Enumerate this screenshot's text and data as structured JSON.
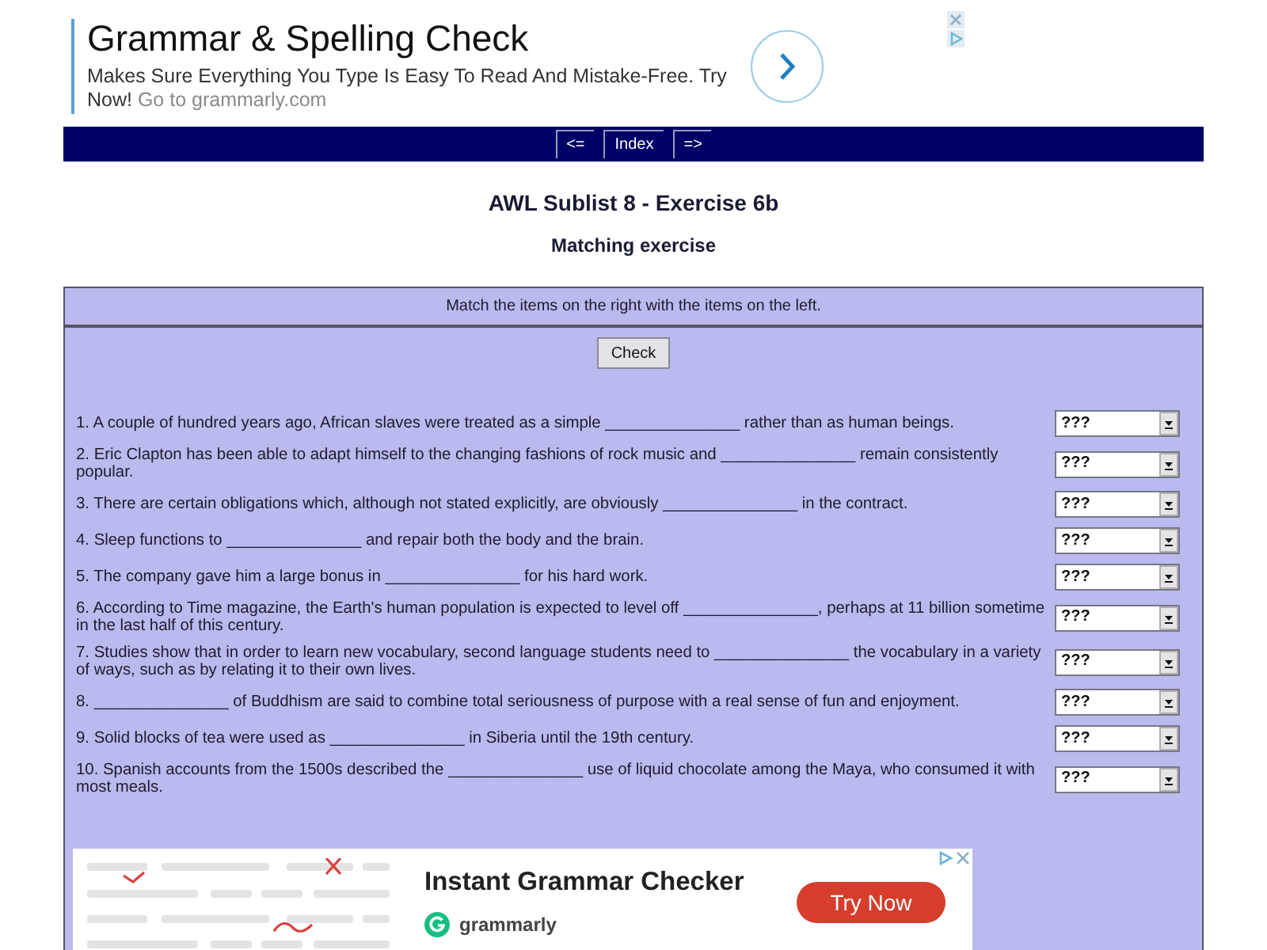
{
  "top_ad": {
    "headline": "Grammar & Spelling Check",
    "text": "Makes Sure Everything You Type Is Easy To Read And Mistake-Free. Try Now!",
    "link": "Go to grammarly.com"
  },
  "nav": [
    {
      "label": "<="
    },
    {
      "label": "Index"
    },
    {
      "label": "=>"
    }
  ],
  "title": "AWL Sublist 8 - Exercise 6b",
  "subtitle": "Matching exercise",
  "instructions": "Match the items on the right with the items on the left.",
  "check_button": "Check",
  "questions": [
    {
      "lines": [
        "1. A couple of hundred years ago, African slaves were treated as a simple _______________ rather than as human beings."
      ],
      "answer": "???"
    },
    {
      "lines": [
        "2. Eric Clapton has been able to adapt himself to the changing fashions of rock music and _______________ remain consistently",
        "popular."
      ],
      "answer": "???"
    },
    {
      "lines": [
        "3. There are certain obligations which, although not stated explicitly, are obviously _______________ in the contract."
      ],
      "answer": "???"
    },
    {
      "lines": [
        "4. Sleep functions to _______________ and repair both the body and the brain."
      ],
      "answer": "???"
    },
    {
      "lines": [
        "5. The company gave him a large bonus in _______________ for his hard work."
      ],
      "answer": "???"
    },
    {
      "lines": [
        "6. According to Time magazine, the Earth's human population is expected to level off _______________, perhaps at 11 billion sometime",
        "in the last half of this century."
      ],
      "answer": "???"
    },
    {
      "lines": [
        "7. Studies show that in order to learn new vocabulary, second language students need to _______________ the vocabulary in a variety",
        "of ways, such as by relating it to their own lives."
      ],
      "answer": "???"
    },
    {
      "lines": [
        "8. _______________ of Buddhism are said to combine total seriousness of purpose with a real sense of fun and enjoyment."
      ],
      "answer": "???"
    },
    {
      "lines": [
        "9. Solid blocks of tea were used as _______________ in Siberia until the 19th century."
      ],
      "answer": "???"
    },
    {
      "lines": [
        "10. Spanish accounts from the 1500s described the _______________ use of liquid chocolate among the Maya, who consumed it with",
        "most meals."
      ],
      "answer": "???"
    }
  ],
  "bottom_ad": {
    "headline": "Instant Grammar Checker",
    "brand": "grammarly",
    "button": "Try Now"
  }
}
